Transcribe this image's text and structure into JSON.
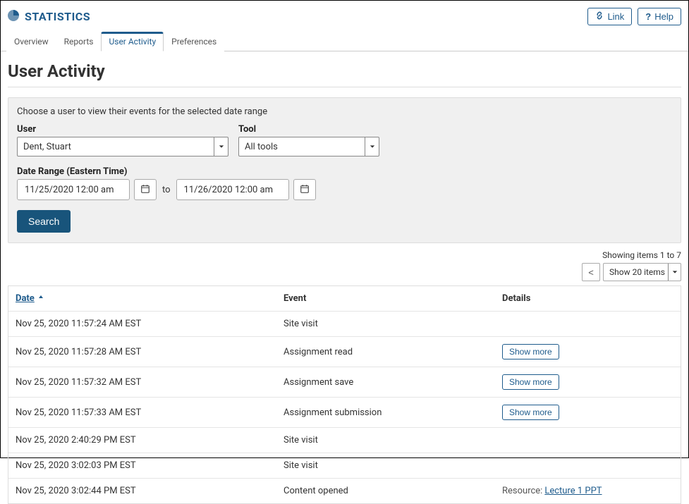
{
  "header": {
    "title": "STATISTICS",
    "link_button": "Link",
    "help_button": "Help"
  },
  "tabs": [
    {
      "label": "Overview",
      "active": false
    },
    {
      "label": "Reports",
      "active": false
    },
    {
      "label": "User Activity",
      "active": true
    },
    {
      "label": "Preferences",
      "active": false
    }
  ],
  "page_title": "User Activity",
  "filter": {
    "description": "Choose a user to view their events for the selected date range",
    "user_label": "User",
    "user_value": "Dent, Stuart",
    "tool_label": "Tool",
    "tool_value": "All tools",
    "date_label": "Date Range (Eastern Time)",
    "date_from": "11/25/2020 12:00 am",
    "to_label": "to",
    "date_to": "11/26/2020 12:00 am",
    "search_label": "Search"
  },
  "pager": {
    "showing": "Showing items 1 to 7",
    "prev": "<",
    "items_label": "Show 20 items"
  },
  "table": {
    "columns": {
      "date": "Date",
      "event": "Event",
      "details": "Details"
    },
    "show_more_label": "Show more",
    "resource_prefix": "Resource:",
    "rows": [
      {
        "date": "Nov 25, 2020 11:57:24 AM EST",
        "event": "Site visit",
        "details": {
          "type": "none"
        }
      },
      {
        "date": "Nov 25, 2020 11:57:28 AM EST",
        "event": "Assignment read",
        "details": {
          "type": "more"
        }
      },
      {
        "date": "Nov 25, 2020 11:57:32 AM EST",
        "event": "Assignment save",
        "details": {
          "type": "more"
        }
      },
      {
        "date": "Nov 25, 2020 11:57:33 AM EST",
        "event": "Assignment submission",
        "details": {
          "type": "more"
        }
      },
      {
        "date": "Nov 25, 2020 2:40:29 PM EST",
        "event": "Site visit",
        "details": {
          "type": "none"
        }
      },
      {
        "date": "Nov 25, 2020 3:02:03 PM EST",
        "event": "Site visit",
        "details": {
          "type": "none"
        }
      },
      {
        "date": "Nov 25, 2020 3:02:44 PM EST",
        "event": "Content opened",
        "details": {
          "type": "resource",
          "link": "Lecture 1 PPT"
        }
      }
    ]
  }
}
